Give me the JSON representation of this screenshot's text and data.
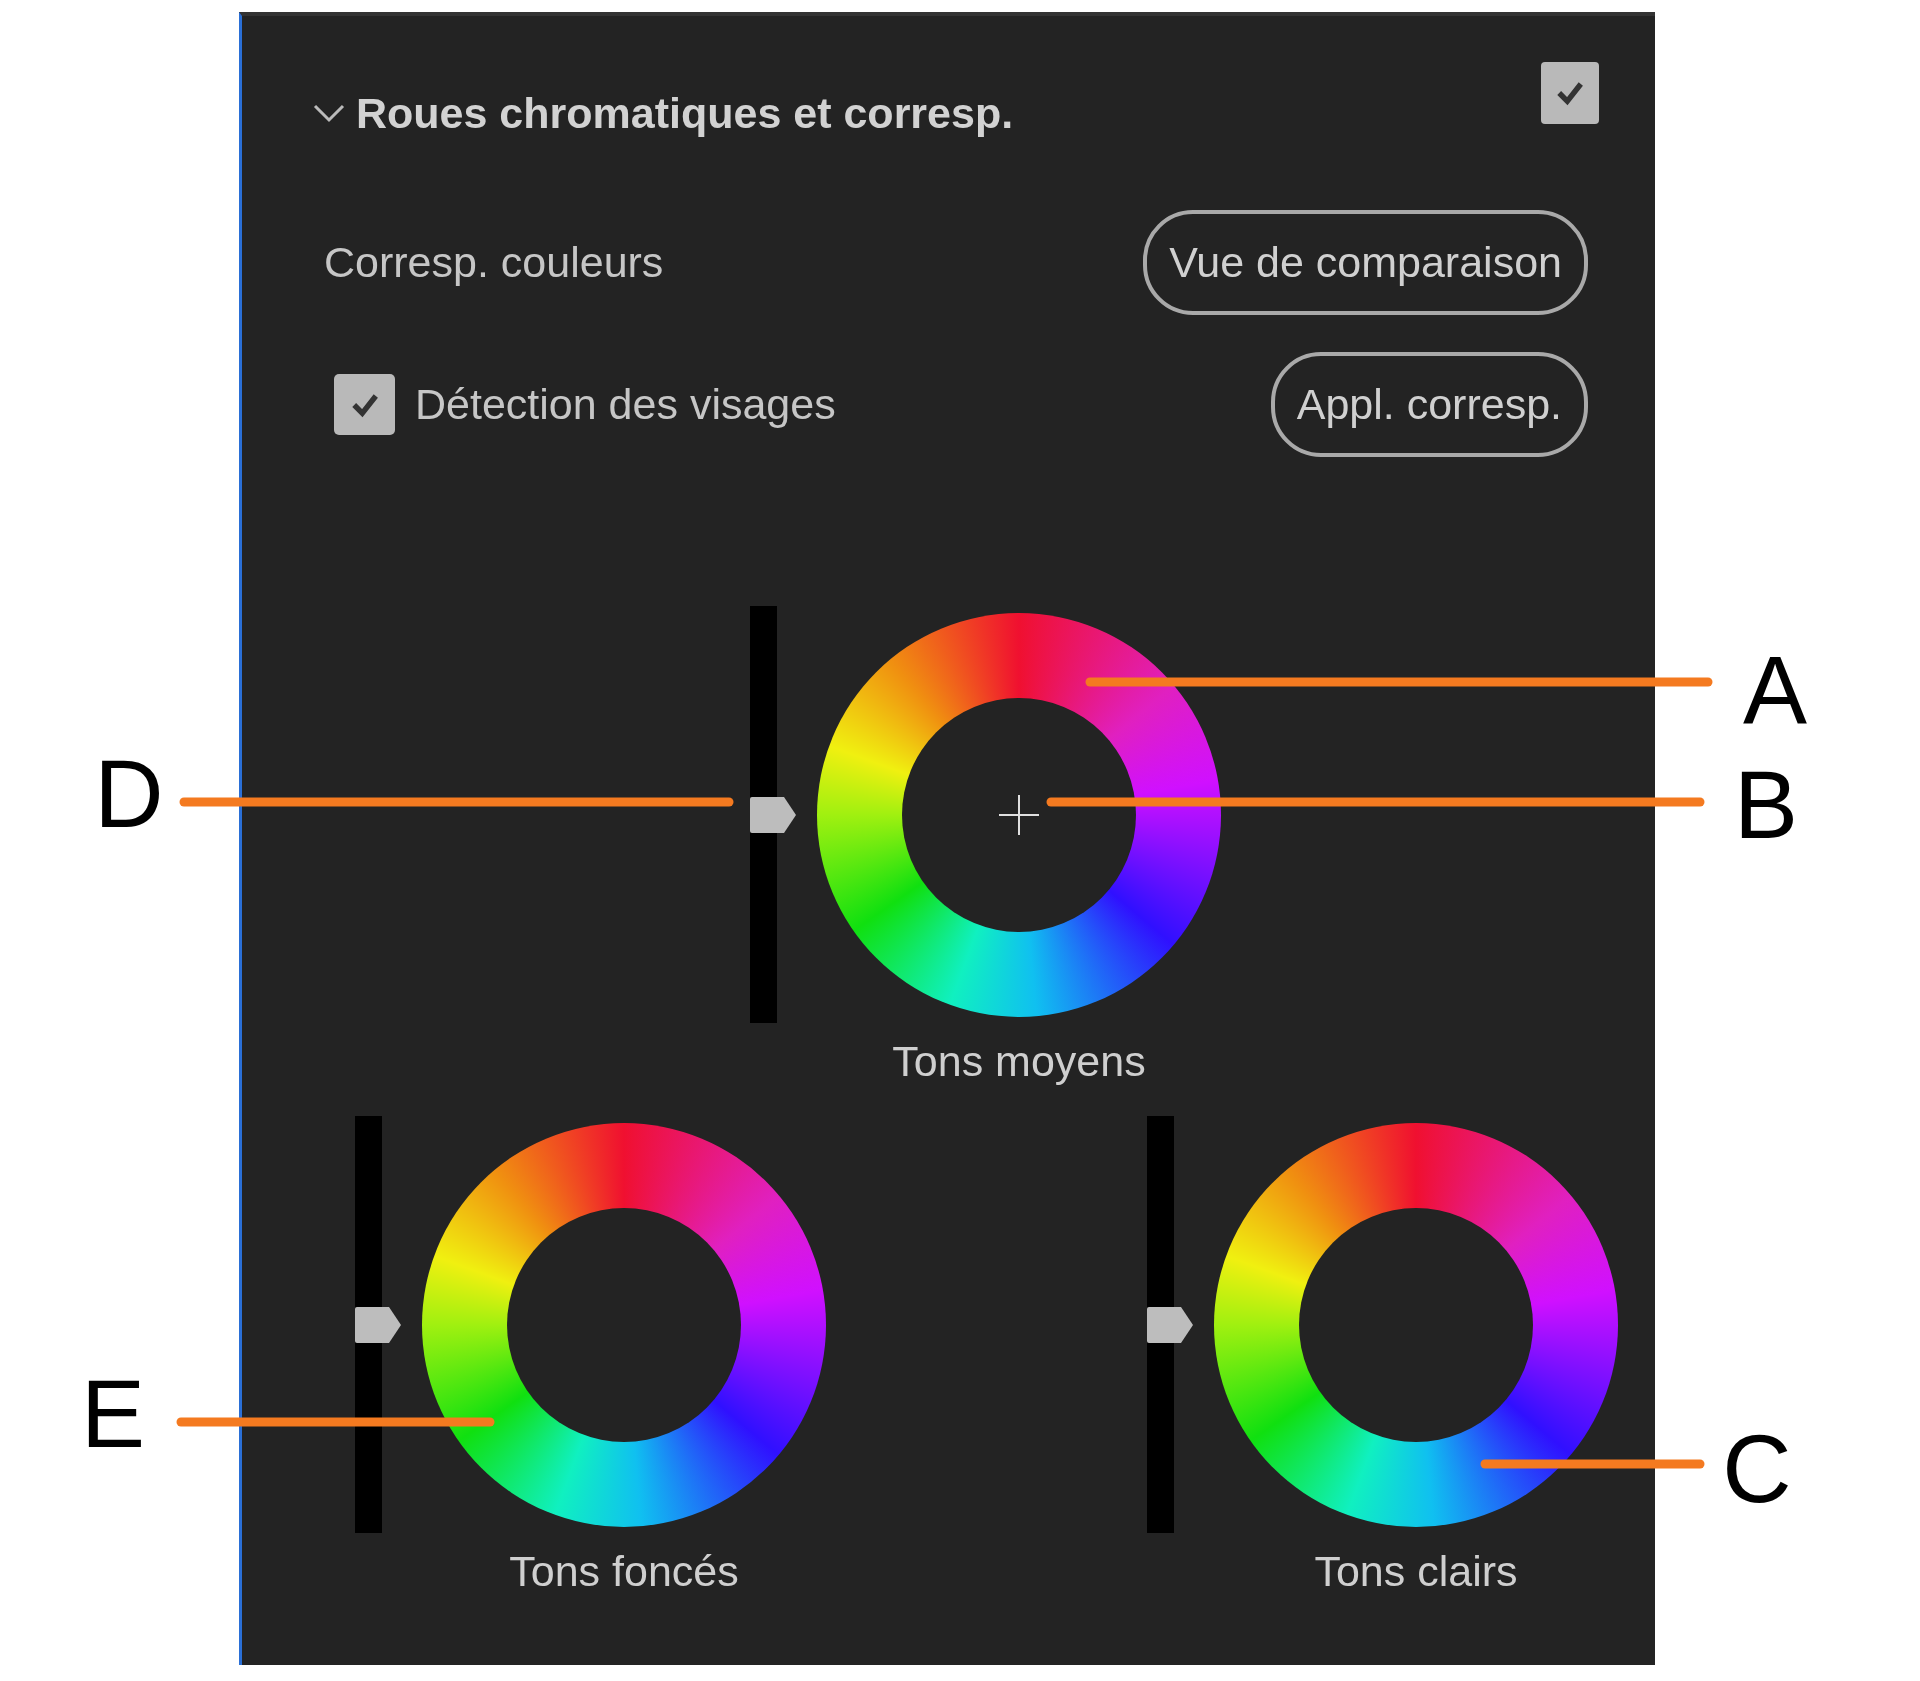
{
  "panel": {
    "title": "Roues chromatiques et corresp.",
    "expanded": true,
    "enabled": true
  },
  "match": {
    "label": "Corresp. couleurs",
    "button": "Vue de comparaison"
  },
  "face_detection": {
    "label": "Détection des visages",
    "checked": true,
    "button": "Appl. corresp."
  },
  "wheels": [
    {
      "label": "Tons moyens",
      "level": 0.5,
      "crosshair": true
    },
    {
      "label": "Tons foncés",
      "level": 0.5,
      "crosshair": false
    },
    {
      "label": "Tons clairs",
      "level": 0.5,
      "crosshair": false
    }
  ],
  "callouts": [
    {
      "letter": "A"
    },
    {
      "letter": "D"
    },
    {
      "letter": "B"
    },
    {
      "letter": "E"
    },
    {
      "letter": "C"
    }
  ]
}
